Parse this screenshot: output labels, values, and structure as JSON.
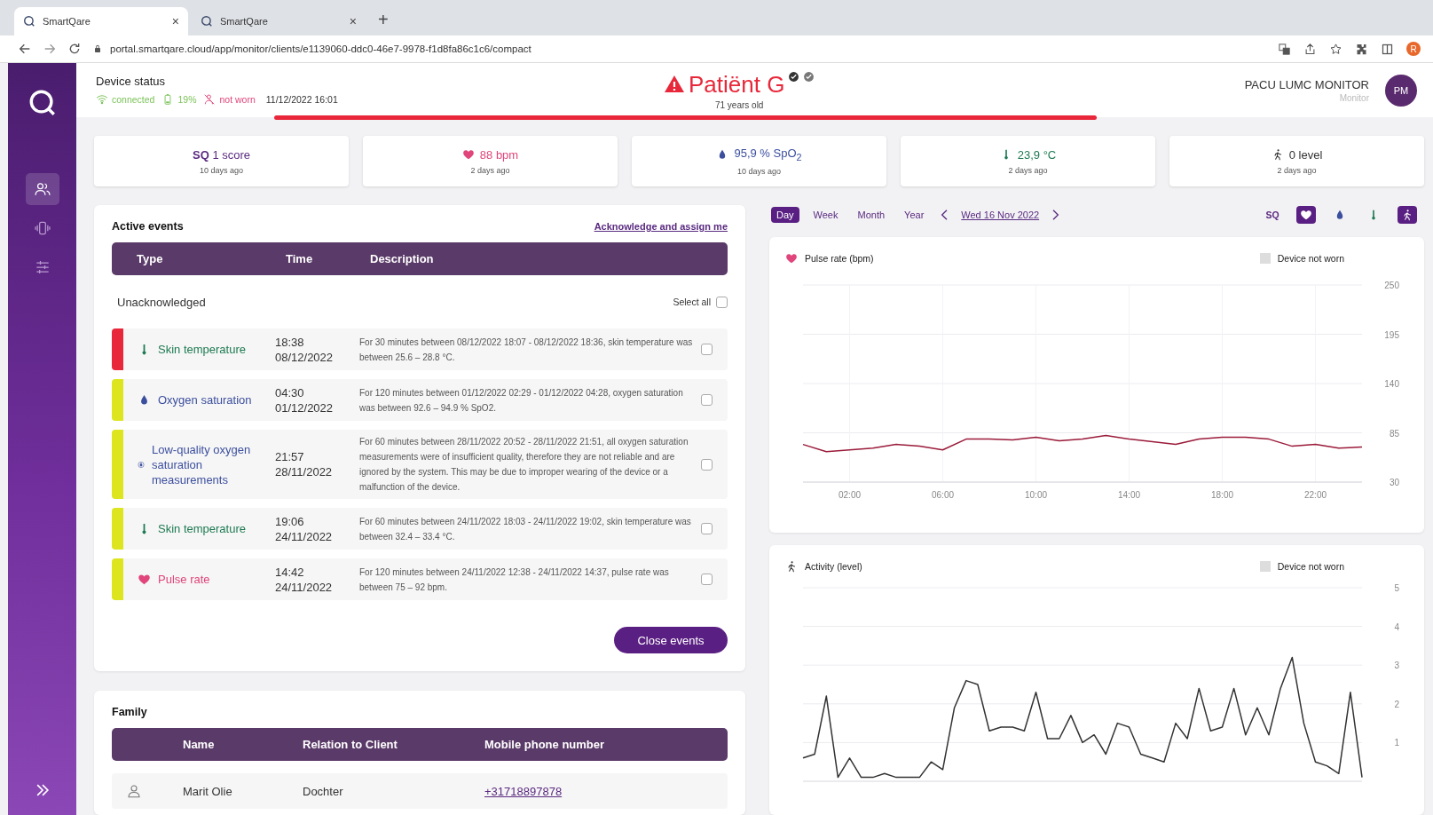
{
  "browser": {
    "tabs": [
      {
        "title": "SmartQare",
        "close": "×",
        "selected": true
      },
      {
        "title": "SmartQare",
        "close": "×",
        "selected": false
      }
    ],
    "new_tab": "+",
    "url": "portal.smartqare.cloud/app/monitor/clients/e1139060-ddc0-46e7-9978-f1d8fa86c1c6/compact",
    "profile_initial": "R"
  },
  "sidebar": {
    "items": [
      {
        "kind": "people",
        "selected": true
      },
      {
        "kind": "device",
        "selected": false
      },
      {
        "kind": "sliders",
        "selected": false
      }
    ]
  },
  "header": {
    "title": "Device status",
    "connection": "connected",
    "battery": "19%",
    "wear": "not worn",
    "timestamp": "11/12/2022 16:01",
    "patient": "Patiënt G",
    "age": "71 years old",
    "unit": "PACU LUMC MONITOR",
    "role": "Monitor",
    "initials": "PM"
  },
  "stats": [
    {
      "kind": "sq",
      "value": "**SQ** 1 score",
      "time": "10 days ago"
    },
    {
      "kind": "heart",
      "value": "88 bpm",
      "time": "2 days ago"
    },
    {
      "kind": "drop",
      "value": "95,9 % SpO$_{2}$",
      "time": "10 days ago"
    },
    {
      "kind": "thermo",
      "value": "23,9 °C",
      "time": "2 days ago"
    },
    {
      "kind": "walk",
      "value": "0 level",
      "time": "2 days ago"
    }
  ],
  "active_events": {
    "title": "Active events",
    "action": "Acknowledge and assign me",
    "columns": [
      "Type",
      "Time",
      "Description"
    ],
    "group": "Unacknowledged",
    "select_all": {
      "label": "Select all",
      "checked": false
    },
    "rows": [
      {
        "kind": "thermo",
        "color": "#e8283a",
        "type": "Skin temperature",
        "time": "18:38",
        "date": "08/12/2022",
        "description": "For 30 minutes between 08/12/2022 18:07 - 08/12/2022 18:36, skin temperature was between 25.6 – 28.8 °C.",
        "checked": false
      },
      {
        "kind": "drop",
        "color": "#dce51e",
        "type": "Oxygen saturation",
        "time": "04:30",
        "date": "01/12/2022",
        "description": "For 120 minutes between 01/12/2022 02:29 - 01/12/2022 04:28, oxygen saturation was between 92.6 – 94.9 % SpO2.",
        "checked": false
      },
      {
        "kind": "lowq",
        "color": "#dce51e",
        "type": "Low-quality oxygen saturation measurements",
        "time": "21:57",
        "date": "28/11/2022",
        "description": "For 60 minutes between 28/11/2022 20:52 - 28/11/2022 21:51, all oxygen saturation measurements were of insufficient quality, therefore they are not reliable and are ignored by the system. This may be due to improper wearing of the device or a malfunction of the device.",
        "checked": false
      },
      {
        "kind": "thermo",
        "color": "#dce51e",
        "type": "Skin temperature",
        "time": "19:06",
        "date": "24/11/2022",
        "description": "For 60 minutes between 24/11/2022 18:03 - 24/11/2022 19:02, skin temperature was between 32.4 – 33.4 °C.",
        "checked": false
      },
      {
        "kind": "heart",
        "color": "#dce51e",
        "type": "Pulse rate",
        "time": "14:42",
        "date": "24/11/2022",
        "description": "For 120 minutes between 24/11/2022 12:38 - 24/11/2022 14:37, pulse rate was between 75 – 92 bpm.",
        "checked": false
      }
    ],
    "button": "Close events"
  },
  "family": {
    "title": "Family",
    "columns": [
      "Name",
      "Relation to Client",
      "Mobile phone number"
    ],
    "rows": [
      {
        "name": "Marit Olie",
        "relation": "Dochter",
        "phone": "+31718897878"
      }
    ]
  },
  "date_nav": {
    "periods": [
      {
        "label": "Day",
        "selected": true
      },
      {
        "label": "Week",
        "selected": false
      },
      {
        "label": "Month",
        "selected": false
      },
      {
        "label": "Year",
        "selected": false
      }
    ],
    "date": "Wed 16 Nov 2022",
    "metrics": [
      {
        "kind": "sq",
        "label": "SQ",
        "selected": false
      },
      {
        "kind": "heart",
        "selected": true
      },
      {
        "kind": "drop",
        "selected": false
      },
      {
        "kind": "thermo",
        "selected": false
      },
      {
        "kind": "walk",
        "selected": true
      }
    ]
  },
  "pulse_chart": {
    "kind": "heart",
    "title": "Pulse rate (bpm)",
    "legend": "Device not worn",
    "chart_data": {
      "type": "line",
      "grid": true,
      "xlim": [
        0,
        24
      ],
      "ylim": [
        30,
        250
      ],
      "xticks": [
        {
          "value": 2,
          "label": "02:00"
        },
        {
          "value": 6,
          "label": "06:00"
        },
        {
          "value": 10,
          "label": "10:00"
        },
        {
          "value": 14,
          "label": "14:00"
        },
        {
          "value": 18,
          "label": "18:00"
        },
        {
          "value": 22,
          "label": "22:00"
        }
      ],
      "yticks": [
        30,
        85,
        140,
        195,
        250
      ],
      "x": [
        0,
        1,
        2,
        3,
        4,
        5,
        6,
        7,
        8,
        9,
        10,
        11,
        12,
        13,
        14,
        15,
        16,
        17,
        18,
        19,
        20,
        21,
        22,
        23,
        24
      ],
      "series": [
        {
          "color": "#9b1b3a",
          "values": [
            72,
            64,
            66,
            68,
            72,
            70,
            66,
            78,
            78,
            77,
            80,
            76,
            78,
            82,
            78,
            75,
            72,
            78,
            80,
            80,
            78,
            70,
            72,
            68,
            69
          ]
        }
      ]
    }
  },
  "activity_chart": {
    "kind": "walk",
    "title": "Activity (level)",
    "legend": "Device not worn",
    "chart_data": {
      "type": "line",
      "grid": true,
      "ylim": [
        0,
        5
      ],
      "yticks": [
        1,
        2,
        3,
        4,
        5
      ],
      "series": [
        {
          "color": "#333333",
          "values": [
            0.6,
            0.7,
            2.2,
            0.1,
            0.6,
            0.1,
            0.1,
            0.2,
            0.1,
            0.1,
            0.1,
            0.5,
            0.3,
            1.9,
            2.6,
            2.5,
            1.3,
            1.4,
            1.4,
            1.3,
            2.3,
            1.1,
            1.1,
            1.7,
            1.0,
            1.2,
            0.7,
            1.5,
            1.4,
            0.7,
            0.6,
            0.5,
            1.5,
            1.1,
            2.4,
            1.3,
            1.4,
            2.4,
            1.2,
            1.9,
            1.2,
            2.4,
            3.2,
            1.5,
            0.5,
            0.4,
            0.2,
            2.3,
            0.1
          ]
        }
      ]
    }
  }
}
